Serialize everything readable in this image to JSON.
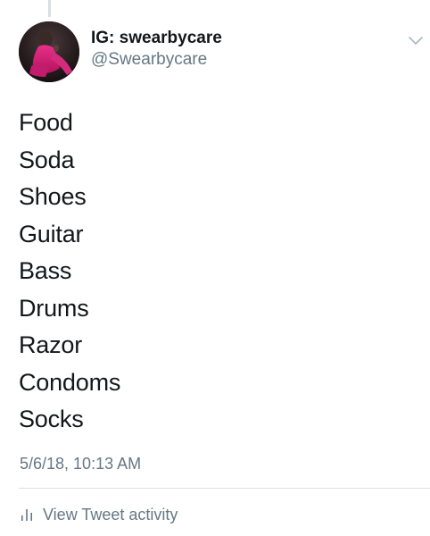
{
  "tweet": {
    "author": {
      "display_name": "IG: swearbycare",
      "handle": "@Swearbycare"
    },
    "lines": [
      "Food",
      "Soda",
      "Shoes",
      "Guitar",
      "Bass",
      "Drums",
      "Razor",
      "Condoms",
      "Socks"
    ],
    "timestamp": "5/6/18, 10:13 AM",
    "activity_label": "View Tweet activity"
  },
  "icons": {
    "menu": "chevron-down-icon",
    "activity": "bar-chart-icon"
  },
  "colors": {
    "text_primary": "#14171a",
    "text_secondary": "#657786",
    "divider": "#d8dee3",
    "chevron": "#aab8c2"
  }
}
